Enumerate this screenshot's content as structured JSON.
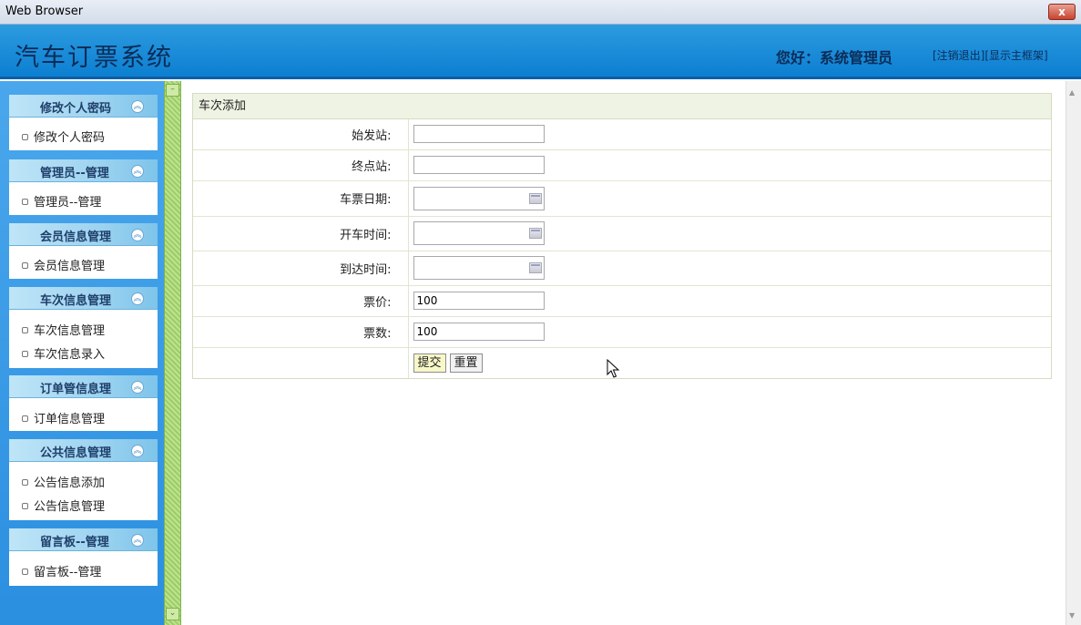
{
  "window": {
    "title": "Web Browser",
    "close_label": "x"
  },
  "header": {
    "app_title": "汽车订票系统",
    "greeting": "您好：系统管理员",
    "logout_link": "[注销退出]",
    "main_frame_link": "[显示主框架]"
  },
  "sidebar": {
    "groups": [
      {
        "title": "修改个人密码",
        "items": [
          "修改个人密码"
        ]
      },
      {
        "title": "管理员--管理",
        "items": [
          "管理员--管理"
        ]
      },
      {
        "title": "会员信息管理",
        "items": [
          "会员信息管理"
        ]
      },
      {
        "title": "车次信息管理",
        "items": [
          "车次信息管理",
          "车次信息录入"
        ]
      },
      {
        "title": "订单管信息理",
        "items": [
          "订单信息管理"
        ]
      },
      {
        "title": "公共信息管理",
        "items": [
          "公告信息添加",
          "公告信息管理"
        ]
      },
      {
        "title": "留言板--管理",
        "items": [
          "留言板--管理"
        ]
      }
    ]
  },
  "form": {
    "title": "车次添加",
    "fields": [
      {
        "label": "始发站:",
        "value": ""
      },
      {
        "label": "终点站:",
        "value": ""
      },
      {
        "label": "车票日期:",
        "value": ""
      },
      {
        "label": "开车时间:",
        "value": ""
      },
      {
        "label": "到达时间:",
        "value": ""
      },
      {
        "label": "票价:",
        "value": "100"
      },
      {
        "label": "票数:",
        "value": "100"
      }
    ],
    "submit_label": "提交",
    "reset_label": "重置"
  }
}
